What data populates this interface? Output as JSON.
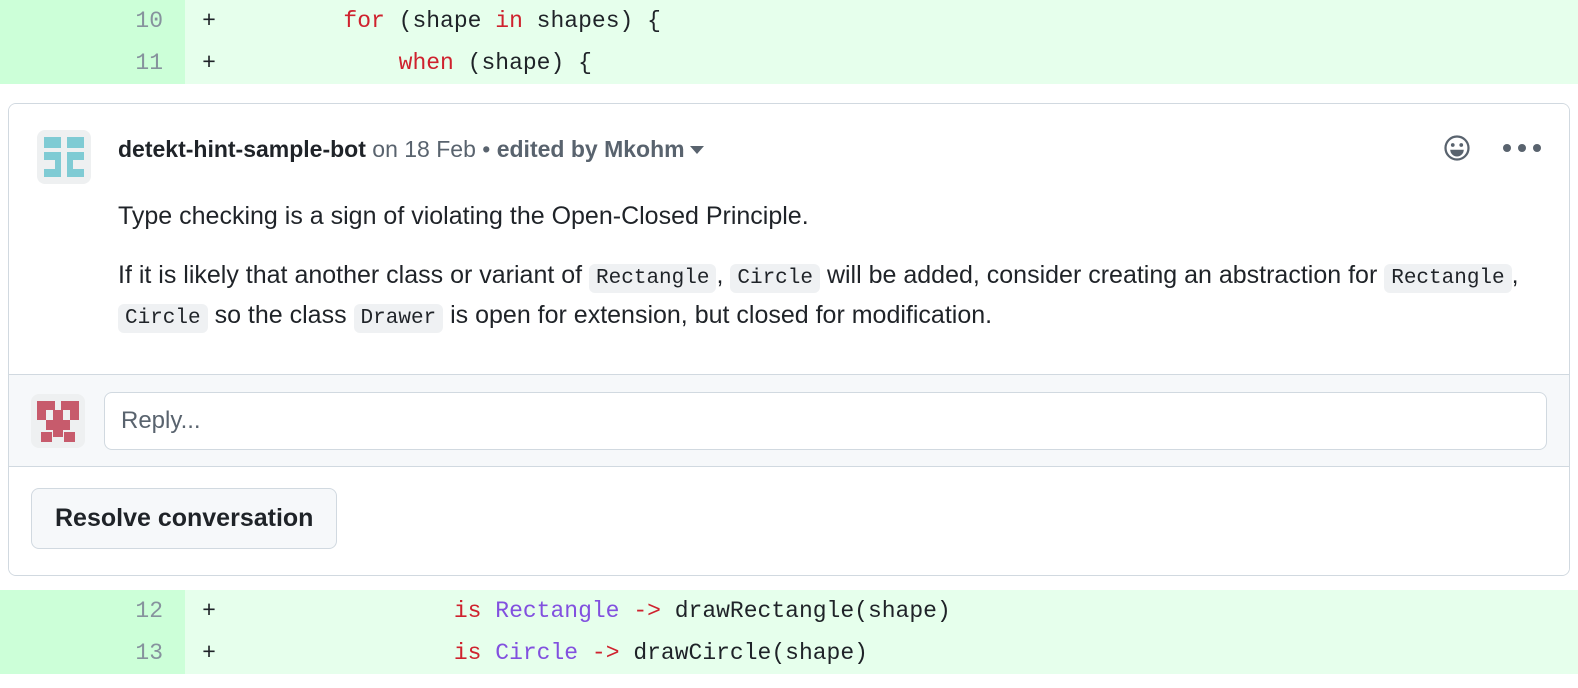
{
  "diff_top": {
    "rows": [
      {
        "line": "10",
        "marker": "+",
        "indent": "        ",
        "tokens": [
          {
            "t": "for",
            "c": "k-red"
          },
          {
            "t": " (shape ",
            "c": ""
          },
          {
            "t": "in",
            "c": "k-red"
          },
          {
            "t": " shapes) {",
            "c": ""
          }
        ]
      },
      {
        "line": "11",
        "marker": "+",
        "indent": "            ",
        "tokens": [
          {
            "t": "when",
            "c": "k-red"
          },
          {
            "t": " (shape) {",
            "c": ""
          }
        ]
      }
    ]
  },
  "diff_bottom": {
    "rows": [
      {
        "line": "12",
        "marker": "+",
        "indent": "                ",
        "tokens": [
          {
            "t": "is",
            "c": "k-red"
          },
          {
            "t": " ",
            "c": ""
          },
          {
            "t": "Rectangle",
            "c": "k-purple"
          },
          {
            "t": " ",
            "c": ""
          },
          {
            "t": "->",
            "c": "k-red"
          },
          {
            "t": " drawRectangle(shape)",
            "c": ""
          }
        ]
      },
      {
        "line": "13",
        "marker": "+",
        "indent": "                ",
        "tokens": [
          {
            "t": "is",
            "c": "k-red"
          },
          {
            "t": " ",
            "c": ""
          },
          {
            "t": "Circle",
            "c": "k-purple"
          },
          {
            "t": " ",
            "c": ""
          },
          {
            "t": "->",
            "c": "k-red"
          },
          {
            "t": " drawCircle(shape)",
            "c": ""
          }
        ]
      }
    ]
  },
  "comment": {
    "author": "detekt-hint-sample-bot",
    "timestamp": "on 18 Feb",
    "separator": "•",
    "edited_by": "edited by Mkohm",
    "avatar_name": "detekt-bot-avatar",
    "reaction_icon": "smiley-icon",
    "menu_icon": "kebab-menu-icon",
    "paragraph_1": "Type checking is a sign of violating the Open-Closed Principle.",
    "paragraph_2": {
      "part_1": "If it is likely that another class or variant of ",
      "code_1": "Rectangle",
      "part_2": ", ",
      "code_2": "Circle",
      "part_3": " will be added, consider creating an abstraction for ",
      "code_3": "Rectangle",
      "part_4": ", ",
      "code_4": "Circle",
      "part_5": " so the class ",
      "code_5": "Drawer",
      "part_6": " is open for extension, but closed for modification."
    }
  },
  "reply": {
    "placeholder": "Reply...",
    "value": "",
    "avatar_name": "user-identicon-avatar"
  },
  "actions": {
    "resolve_label": "Resolve conversation"
  },
  "colors": {
    "diff_add_bg": "#e6ffec",
    "diff_add_gutter": "#ccffd8",
    "keyword_red": "#cf222e",
    "type_purple": "#8250df",
    "border": "#d1d9e0",
    "muted_text": "#59636e",
    "avatar_teal": "#7fcbd4",
    "identicon_red": "#c75b6c",
    "canvas_subtle": "#f6f8fa"
  }
}
